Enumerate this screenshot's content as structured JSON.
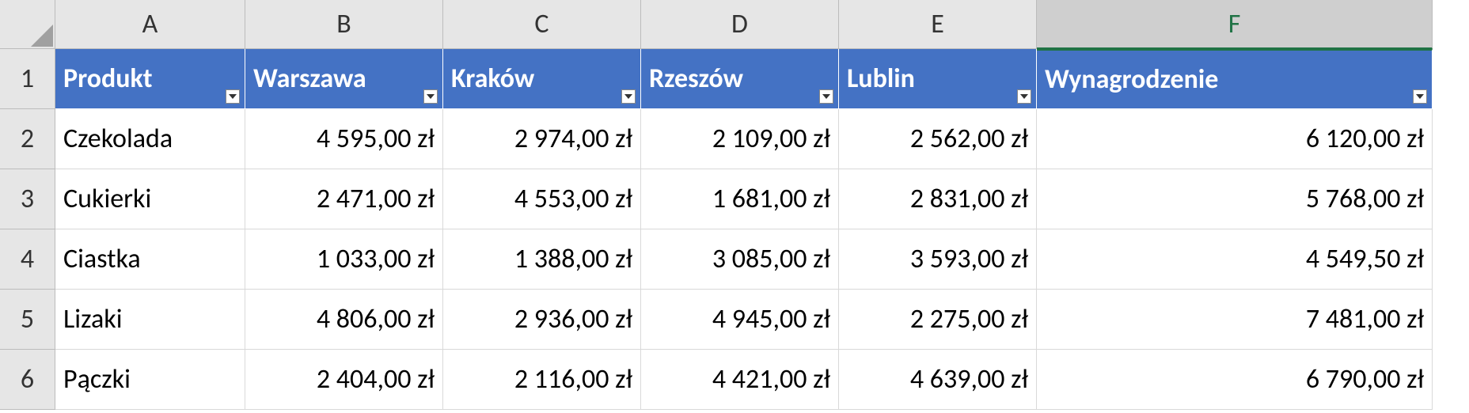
{
  "columns": [
    "A",
    "B",
    "C",
    "D",
    "E",
    "F"
  ],
  "rows": [
    "1",
    "2",
    "3",
    "4",
    "5",
    "6"
  ],
  "selected_column_index": 5,
  "headers": {
    "A": "Produkt",
    "B": "Warszawa",
    "C": "Kraków",
    "D": "Rzeszów",
    "E": "Lublin",
    "F": "Wynagrodzenie"
  },
  "data": [
    {
      "A": "Czekolada",
      "B": "4 595,00 zł",
      "C": "2 974,00 zł",
      "D": "2 109,00 zł",
      "E": "2 562,00 zł",
      "F": "6 120,00 zł"
    },
    {
      "A": "Cukierki",
      "B": "2 471,00 zł",
      "C": "4 553,00 zł",
      "D": "1 681,00 zł",
      "E": "2 831,00 zł",
      "F": "5 768,00 zł"
    },
    {
      "A": "Ciastka",
      "B": "1 033,00 zł",
      "C": "1 388,00 zł",
      "D": "3 085,00 zł",
      "E": "3 593,00 zł",
      "F": "4 549,50 zł"
    },
    {
      "A": "Lizaki",
      "B": "4 806,00 zł",
      "C": "2 936,00 zł",
      "D": "4 945,00 zł",
      "E": "2 275,00 zł",
      "F": "7 481,00 zł"
    },
    {
      "A": "Pączki",
      "B": "2 404,00 zł",
      "C": "2 116,00 zł",
      "D": "4 421,00 zł",
      "E": "4 639,00 zł",
      "F": "6 790,00 zł"
    }
  ],
  "chart_data": {
    "type": "table",
    "columns": [
      "Produkt",
      "Warszawa",
      "Kraków",
      "Rzeszów",
      "Lublin",
      "Wynagrodzenie"
    ],
    "currency": "zł",
    "rows": [
      {
        "Produkt": "Czekolada",
        "Warszawa": 4595.0,
        "Kraków": 2974.0,
        "Rzeszów": 2109.0,
        "Lublin": 2562.0,
        "Wynagrodzenie": 6120.0
      },
      {
        "Produkt": "Cukierki",
        "Warszawa": 2471.0,
        "Kraków": 4553.0,
        "Rzeszów": 1681.0,
        "Lublin": 2831.0,
        "Wynagrodzenie": 5768.0
      },
      {
        "Produkt": "Ciastka",
        "Warszawa": 1033.0,
        "Kraków": 1388.0,
        "Rzeszów": 3085.0,
        "Lublin": 3593.0,
        "Wynagrodzenie": 4549.5
      },
      {
        "Produkt": "Lizaki",
        "Warszawa": 4806.0,
        "Kraków": 2936.0,
        "Rzeszów": 4945.0,
        "Lublin": 2275.0,
        "Wynagrodzenie": 7481.0
      },
      {
        "Produkt": "Pączki",
        "Warszawa": 2404.0,
        "Kraków": 2116.0,
        "Rzeszów": 4421.0,
        "Lublin": 4639.0,
        "Wynagrodzenie": 6790.0
      }
    ]
  }
}
